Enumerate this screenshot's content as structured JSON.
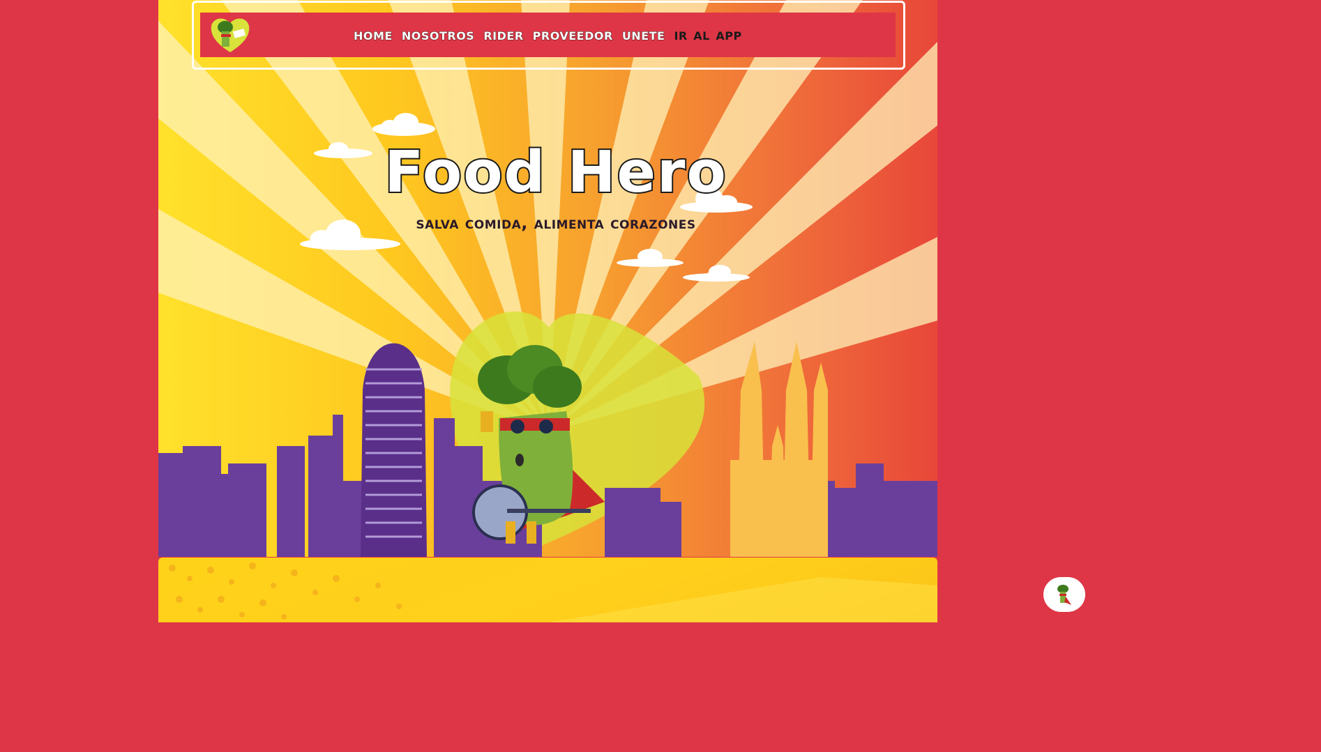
{
  "nav": {
    "logo_icon": "food-hero-broccoli-logo",
    "items": [
      {
        "label": "Home",
        "active": false
      },
      {
        "label": "Nosotros",
        "active": false
      },
      {
        "label": "Rider",
        "active": false
      },
      {
        "label": "Proveedor",
        "active": false
      },
      {
        "label": "Unete",
        "active": false
      },
      {
        "label": "Ir al APP",
        "active": true
      }
    ]
  },
  "hero": {
    "title": "Food Hero",
    "subtitle": "Salva comida, alimenta corazones",
    "illustration": "broccoli-superhero-barcelona-skyline"
  },
  "chat_widget": {
    "icon": "broccoli-hero-chat-icon"
  },
  "colors": {
    "brand_red": "#de3646",
    "sunburst_yellow": "#ffe12b",
    "sunburst_orange": "#f0703a",
    "skyline_purple": "#6a3f9c",
    "heart_lime": "#d8e23a"
  }
}
